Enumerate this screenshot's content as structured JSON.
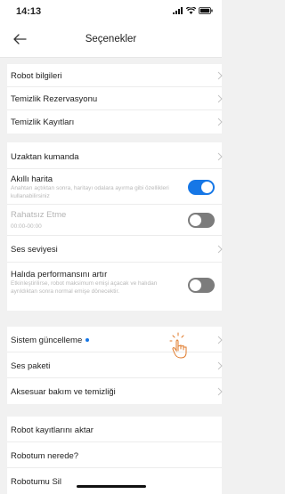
{
  "status_bar": {
    "time": "14:13"
  },
  "header": {
    "title": "Seçenekler"
  },
  "groups": [
    {
      "items": [
        {
          "label": "Robot bilgileri"
        },
        {
          "label": "Temizlik Rezervasyonu"
        },
        {
          "label": "Temizlik Kayıtları"
        }
      ]
    },
    {
      "items": [
        {
          "label": "Uzaktan kumanda"
        },
        {
          "label": "Akıllı harita",
          "desc": "Anahtarı açtıktan sonra, haritayı odalara ayırma gibi özellikleri kullanabilirsiniz",
          "toggle": "on"
        },
        {
          "label": "Rahatsız Etme",
          "desc": "00:00-00:00",
          "toggle": "off"
        },
        {
          "label": "Ses seviyesi"
        },
        {
          "label": "Halıda performansını artır",
          "desc": "Etkinleştirilirse, robot maksimum emişi açacak ve halıdan ayrıldıktan sonra normal emişe dönecektir.",
          "toggle": "off"
        }
      ]
    },
    {
      "items": [
        {
          "label": "Sistem güncelleme"
        },
        {
          "label": "Ses paketi"
        },
        {
          "label": "Aksesuar bakım ve temizliği"
        }
      ]
    },
    {
      "items": [
        {
          "label": "Robot kayıtlarını aktar"
        },
        {
          "label": "Robotum nerede?"
        },
        {
          "label": "Robotumu Sil"
        }
      ]
    }
  ],
  "colors": {
    "accent": "#1677e6",
    "toggle_off": "#7c7c7c",
    "background": "#f1f1f1"
  }
}
